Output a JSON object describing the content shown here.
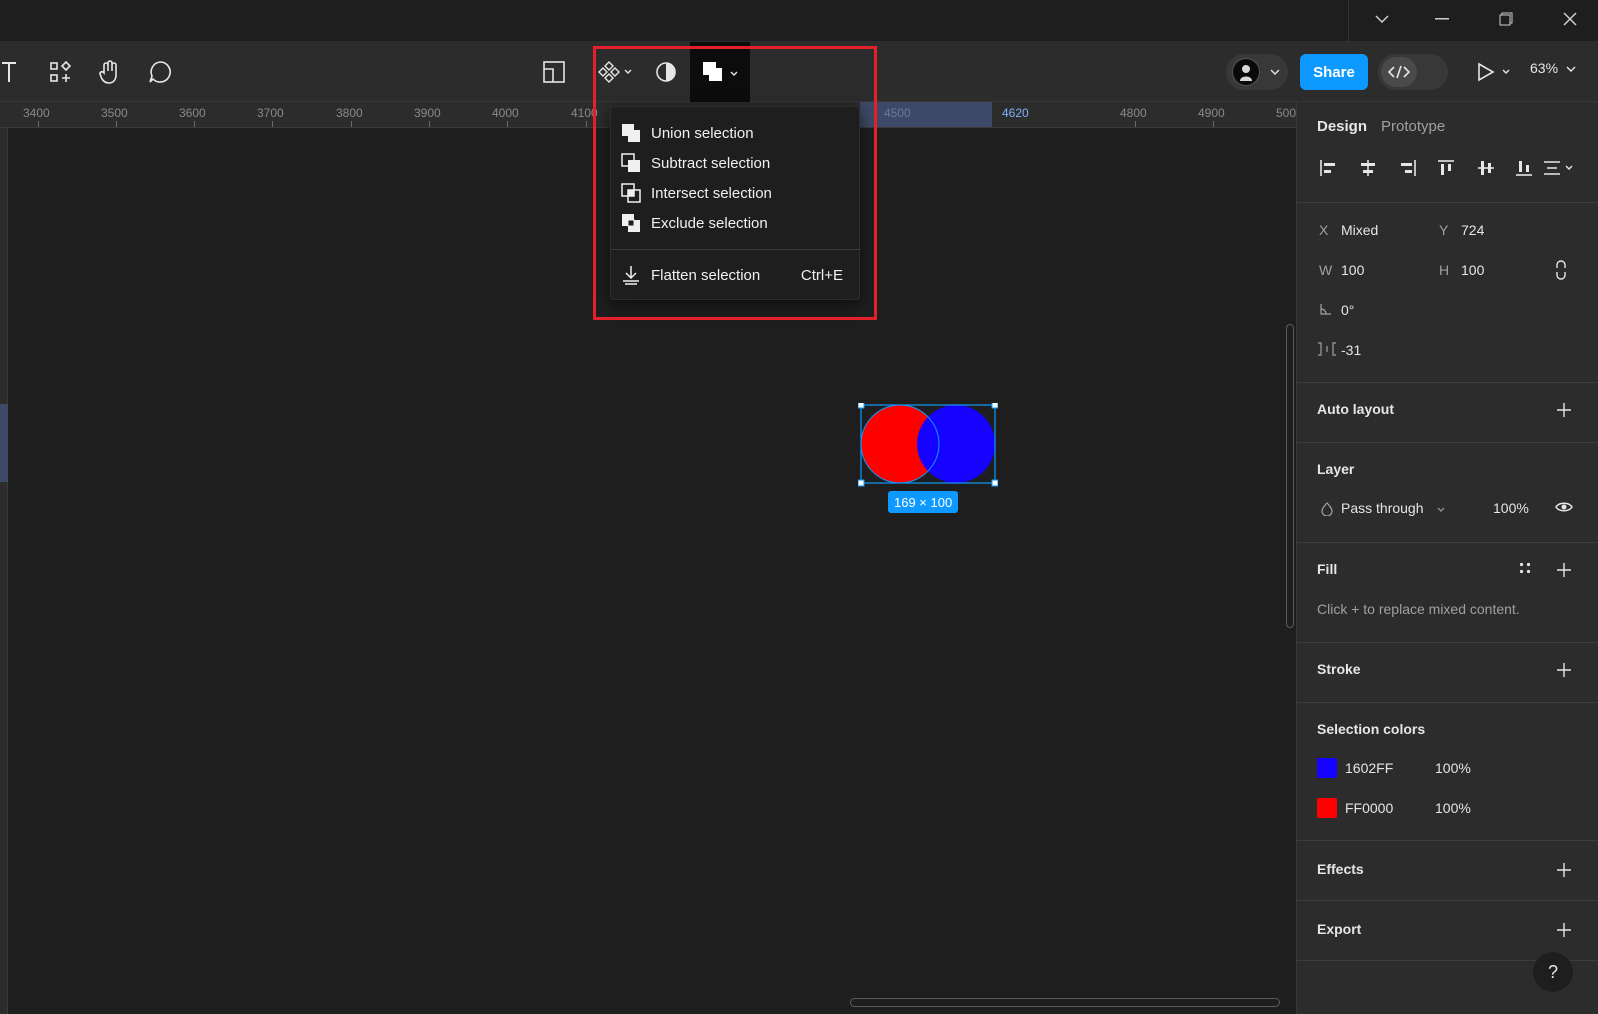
{
  "window": {
    "controls": [
      "chevron-down",
      "minimize",
      "restore",
      "close"
    ]
  },
  "toolbar": {
    "share_label": "Share",
    "zoom": "63%"
  },
  "ruler": {
    "ticks": [
      "3400",
      "3500",
      "3600",
      "3700",
      "3800",
      "3900",
      "4000",
      "4100",
      "4500",
      "4620",
      "4800",
      "4900",
      "500"
    ]
  },
  "menu": {
    "items": [
      {
        "label": "Union selection",
        "icon": "union-icon"
      },
      {
        "label": "Subtract selection",
        "icon": "subtract-icon"
      },
      {
        "label": "Intersect selection",
        "icon": "intersect-icon"
      },
      {
        "label": "Exclude selection",
        "icon": "exclude-icon"
      }
    ],
    "flatten": {
      "label": "Flatten selection",
      "shortcut": "Ctrl+E"
    }
  },
  "canvas": {
    "selection_size": "169 × 100",
    "shape_colors": {
      "left": "#FF0000",
      "right": "#1602FF"
    }
  },
  "panel": {
    "tabs": {
      "design": "Design",
      "prototype": "Prototype"
    },
    "x_label": "X",
    "x_value": "Mixed",
    "y_label": "Y",
    "y_value": "724",
    "w_label": "W",
    "w_value": "100",
    "h_label": "H",
    "h_value": "100",
    "rotation": "0°",
    "spacing": "-31",
    "auto_layout": "Auto layout",
    "layer": {
      "title": "Layer",
      "blend": "Pass through",
      "opacity": "100%"
    },
    "fill": {
      "title": "Fill",
      "hint": "Click + to replace mixed content."
    },
    "stroke": "Stroke",
    "selection_colors": {
      "title": "Selection colors",
      "colors": [
        {
          "hex": "1602FF",
          "opacity": "100%",
          "swatch": "#1602FF"
        },
        {
          "hex": "FF0000",
          "opacity": "100%",
          "swatch": "#FF0000"
        }
      ]
    },
    "effects": "Effects",
    "export": "Export",
    "help": "?"
  }
}
